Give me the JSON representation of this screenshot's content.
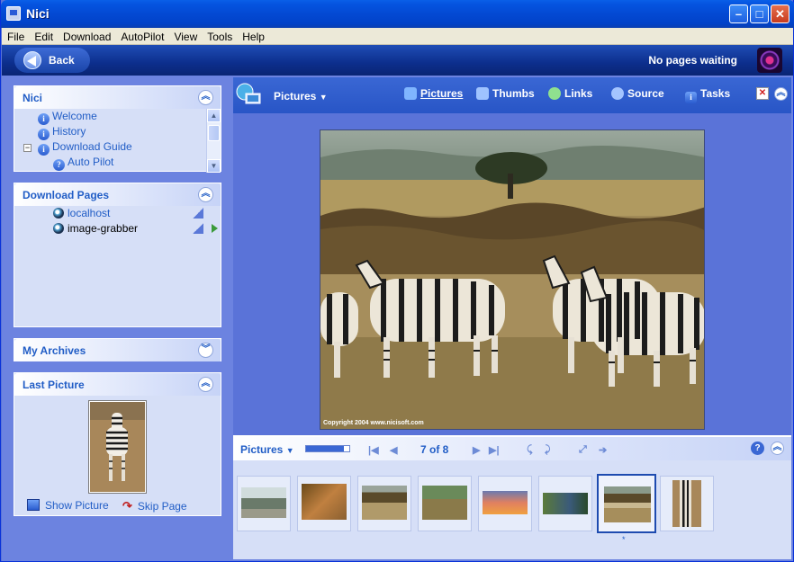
{
  "window": {
    "title": "Nici"
  },
  "menu": [
    "File",
    "Edit",
    "Download",
    "AutoPilot",
    "View",
    "Tools",
    "Help"
  ],
  "nav": {
    "back_label": "Back",
    "status": "No pages waiting"
  },
  "sidebar": {
    "nici": {
      "title": "Nici",
      "items": [
        {
          "label": "Welcome",
          "icon": "info-icon"
        },
        {
          "label": "History",
          "icon": "info-icon"
        },
        {
          "label": "Download Guide",
          "icon": "info-icon",
          "expander": "−"
        },
        {
          "label": "Auto Pilot",
          "icon": "help-icon"
        }
      ]
    },
    "download_pages": {
      "title": "Download Pages",
      "items": [
        {
          "label": "localhost"
        },
        {
          "label": "image-grabber"
        }
      ]
    },
    "archives": {
      "title": "My Archives"
    },
    "last_picture": {
      "title": "Last Picture",
      "show_label": "Show Picture",
      "skip_label": "Skip Page"
    }
  },
  "view": {
    "title": "Pictures",
    "tabs": [
      {
        "label": "Pictures",
        "icon": "monitor-icon",
        "color": "#7fb5ff"
      },
      {
        "label": "Thumbs",
        "icon": "thumbs-icon",
        "color": "#9fc3ff"
      },
      {
        "label": "Links",
        "icon": "links-icon",
        "color": "#8fe08f"
      },
      {
        "label": "Source",
        "icon": "source-icon",
        "color": "#a4c4ff"
      },
      {
        "label": "Tasks",
        "icon": "info-icon",
        "color": "#a4c4ff"
      }
    ],
    "photo_caption": "Copyright 2004 www.nicisoft.com"
  },
  "strip": {
    "title": "Pictures",
    "counter": "7 of 8",
    "progress": 0.875,
    "marker": "*"
  }
}
